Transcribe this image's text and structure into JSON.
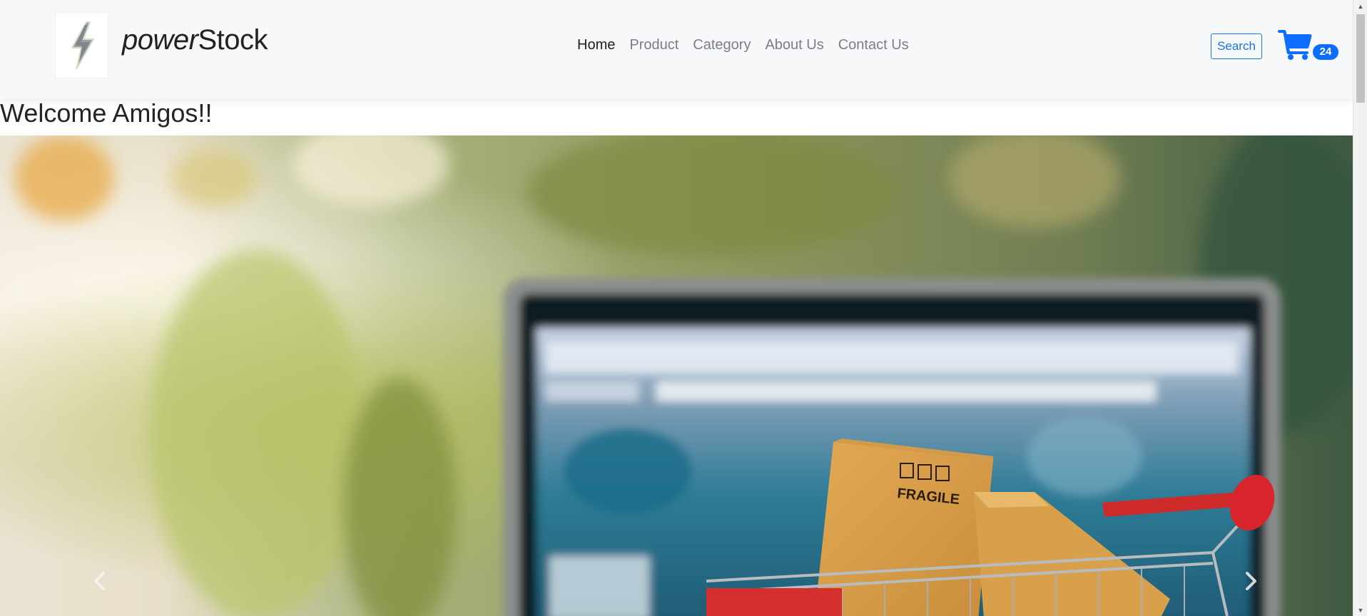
{
  "navbar": {
    "brand_italic": "power",
    "brand_rest": "Stock",
    "logo_icon": "lightning-bolt-icon",
    "links": [
      {
        "label": "Home",
        "active": true
      },
      {
        "label": "Product",
        "active": false
      },
      {
        "label": "Category",
        "active": false
      },
      {
        "label": "About Us",
        "active": false
      },
      {
        "label": "Contact Us",
        "active": false
      }
    ],
    "search_label": "Search",
    "cart_icon": "shopping-cart-icon",
    "cart_count": "24"
  },
  "main": {
    "heading": "Welcome Amigos!!"
  },
  "hero": {
    "image_box_text": "FRAGILE",
    "prev_icon": "chevron-left-icon",
    "next_icon": "chevron-right-icon"
  },
  "colors": {
    "navbar_bg": "#f7f8fa",
    "accent": "#0d6efd",
    "nav_active": "#1f1f1f",
    "nav_inactive": "#7b7f84"
  }
}
